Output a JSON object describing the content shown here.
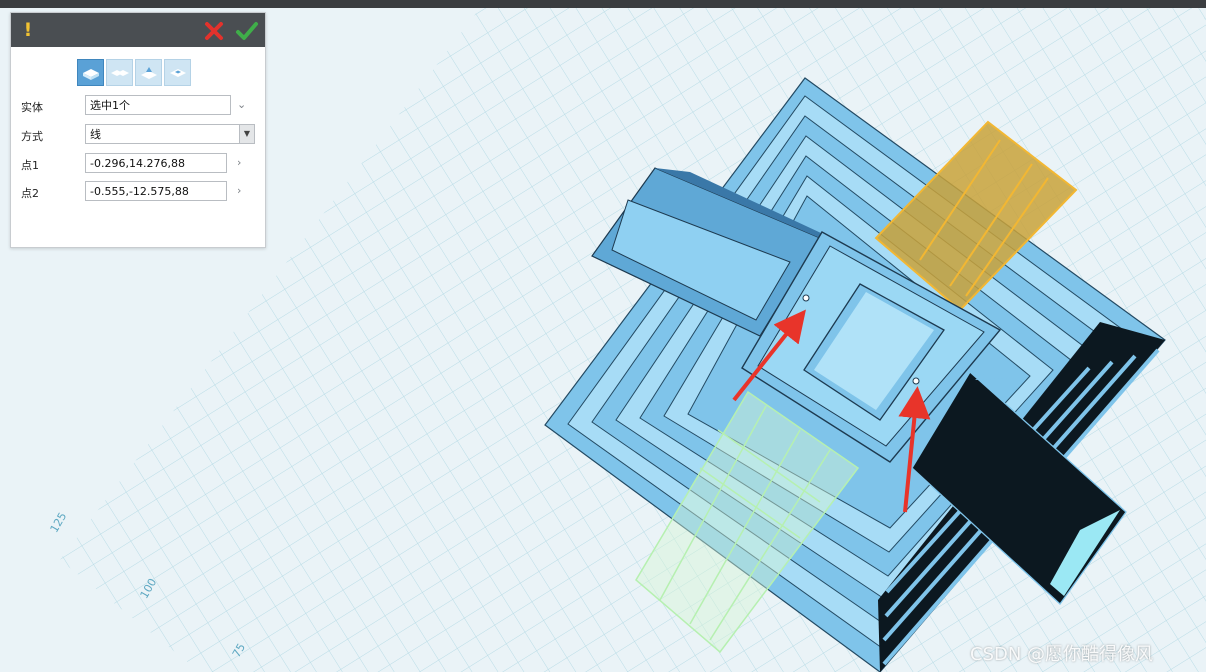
{
  "panel": {
    "mode_buttons": [
      {
        "icon": "solid-blocks-icon",
        "active": true
      },
      {
        "icon": "merge-blocks-icon",
        "active": false
      },
      {
        "icon": "subtract-up-icon",
        "active": false
      },
      {
        "icon": "intersect-icon",
        "active": false
      }
    ],
    "fields": {
      "entity": {
        "label": "实体",
        "value": "选中1个"
      },
      "method": {
        "label": "方式",
        "value": "线"
      },
      "point1": {
        "label": "点1",
        "value": "-0.296,14.276,88"
      },
      "point2": {
        "label": "点2",
        "value": "-0.555,-12.575,88"
      }
    }
  },
  "grid_axis": {
    "labels": [
      "125",
      "100",
      "75"
    ]
  },
  "watermark": "CSDN @愿你酷得像风",
  "colors": {
    "panel_header": "#4a4e52",
    "active_mode": "#5aa1d6",
    "model_blue": "#7fc4ea",
    "highlight_orange": "#f2b733",
    "ghost_green": "#b6f0b0",
    "dark_part": "#0c1820",
    "annotation_arrow": "#e8342a",
    "grid_line": "#b9dce6"
  }
}
